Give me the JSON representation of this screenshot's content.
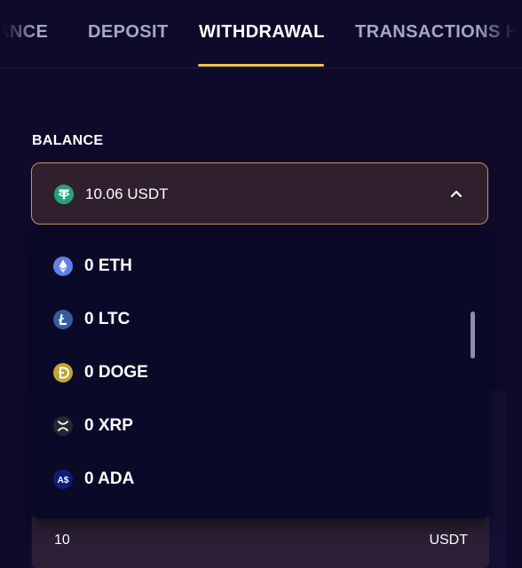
{
  "tabs": [
    {
      "label": "BALANCE",
      "shown": "ANCE"
    },
    {
      "label": "DEPOSIT"
    },
    {
      "label": "WITHDRAWAL",
      "active": true
    },
    {
      "label": "TRANSACTIONS H"
    }
  ],
  "balance": {
    "label": "BALANCE",
    "selected": {
      "text": "10.06 USDT",
      "icon": "tether-icon",
      "color": "#26a17b"
    }
  },
  "dropdown": {
    "items": [
      {
        "label": "0 ETH",
        "icon": "ethereum-icon",
        "color": "#627eea"
      },
      {
        "label": "0 LTC",
        "icon": "litecoin-icon",
        "color": "#345d9d"
      },
      {
        "label": "0 DOGE",
        "icon": "dogecoin-icon",
        "color": "#c2a633"
      },
      {
        "label": "0 XRP",
        "icon": "xrp-icon",
        "color": "#23292f"
      },
      {
        "label": "0 ADA",
        "icon": "cardano-icon",
        "color": "#0d1e7a"
      }
    ]
  },
  "amount": {
    "value": "10",
    "unit": "USDT"
  },
  "colors": {
    "background": "#0d0a2a",
    "accent": "#f3c14f",
    "select_border": "#c89460"
  }
}
